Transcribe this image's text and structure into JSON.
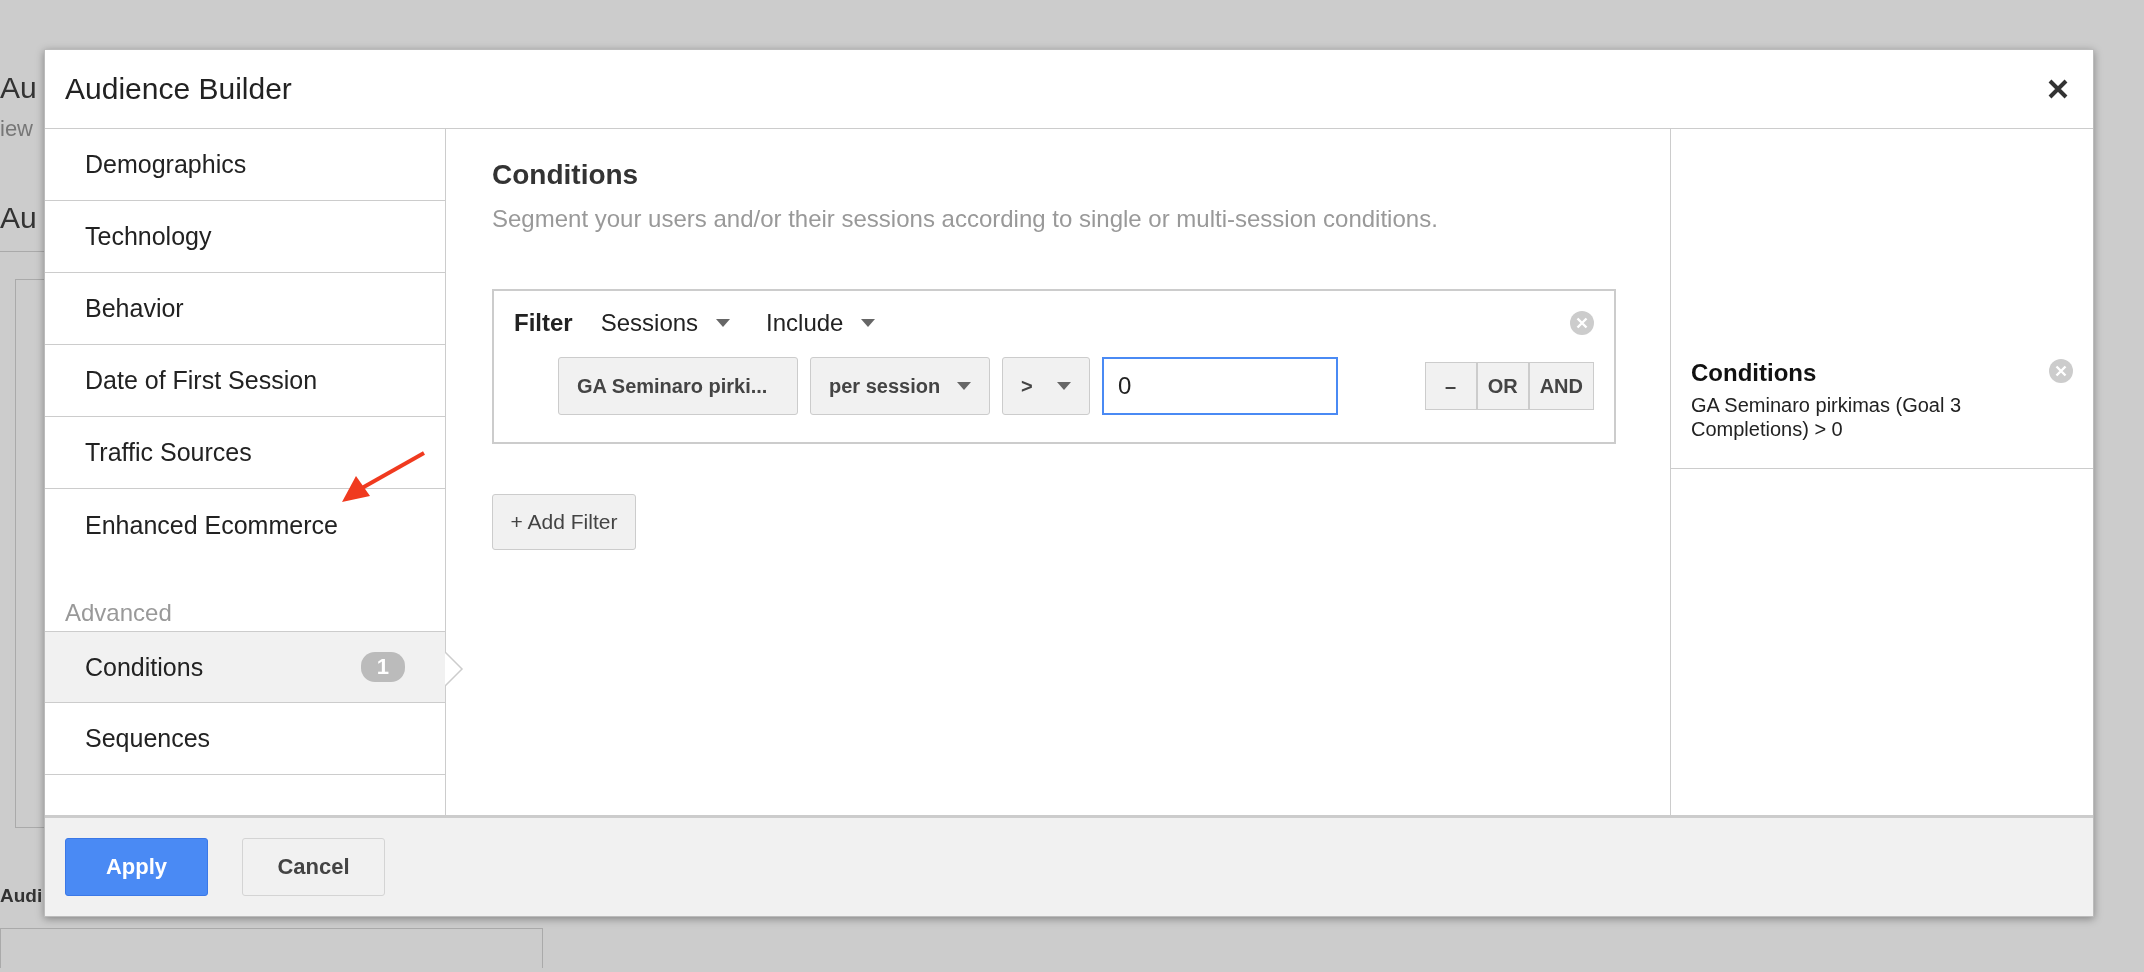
{
  "background_page": {
    "title": "Au",
    "subtitle": "iew",
    "section_title": "Au",
    "lower_title": "Audi"
  },
  "dialog": {
    "title": "Audience Builder",
    "sidebar": {
      "groups": [
        {
          "items": [
            {
              "label": "Demographics",
              "selected": false
            },
            {
              "label": "Technology",
              "selected": false
            },
            {
              "label": "Behavior",
              "selected": false
            },
            {
              "label": "Date of First Session",
              "selected": false
            },
            {
              "label": "Traffic Sources",
              "selected": false
            },
            {
              "label": "Enhanced Ecommerce",
              "selected": false
            }
          ]
        },
        {
          "heading": "Advanced",
          "items": [
            {
              "label": "Conditions",
              "selected": true,
              "badge": "1"
            },
            {
              "label": "Sequences",
              "selected": false
            }
          ]
        }
      ]
    },
    "main": {
      "title": "Conditions",
      "subtitle": "Segment your users and/or their sessions according to single or multi-session conditions.",
      "filter": {
        "label": "Filter",
        "scope": "Sessions",
        "mode": "Include",
        "condition": {
          "metric": "GA Seminaro pirki...",
          "aggregation": "per session",
          "operator": ">",
          "value": "0",
          "value_focused": true,
          "buttons": [
            "–",
            "OR",
            "AND"
          ]
        }
      },
      "add_filter": "+ Add Filter"
    },
    "summary": {
      "title": "Conditions",
      "text": "GA Seminaro pirkimas (Goal 3 Completions) > 0"
    },
    "footer": {
      "buttons": [
        {
          "label": "Apply",
          "kind": "primary"
        },
        {
          "label": "Cancel",
          "kind": "secondary"
        }
      ]
    }
  }
}
